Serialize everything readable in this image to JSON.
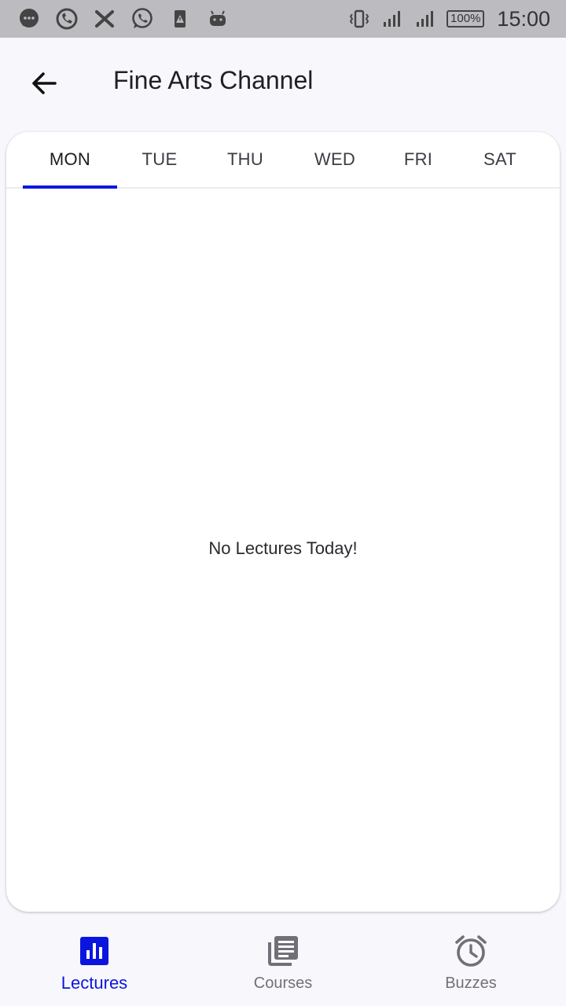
{
  "status_bar": {
    "left_icons": [
      "messages-icon",
      "call-icon",
      "x-icon",
      "whatsapp-icon",
      "alert-file-icon",
      "android-icon"
    ],
    "right_icons": [
      "vibrate-icon",
      "signal-icon",
      "signal-icon"
    ],
    "battery": "100%",
    "time": "15:00"
  },
  "app_bar": {
    "title": "Fine Arts Channel",
    "back_icon": "arrow-back-icon"
  },
  "tabs": [
    {
      "label": "MON",
      "active": true
    },
    {
      "label": "TUE",
      "active": false
    },
    {
      "label": "THU",
      "active": false
    },
    {
      "label": "WED",
      "active": false
    },
    {
      "label": "FRI",
      "active": false
    },
    {
      "label": "SAT",
      "active": false
    }
  ],
  "content": {
    "empty_message": "No Lectures Today!"
  },
  "bottom_nav": {
    "items": [
      {
        "label": "Lectures",
        "icon": "bar-chart-icon",
        "active": true
      },
      {
        "label": "Courses",
        "icon": "library-icon",
        "active": false
      },
      {
        "label": "Buzzes",
        "icon": "alarm-icon",
        "active": false
      }
    ]
  },
  "colors": {
    "accent": "#0a16e0",
    "status_bar": "#bcbbc0",
    "background": "#f8f7fc",
    "inactive": "#707078"
  }
}
